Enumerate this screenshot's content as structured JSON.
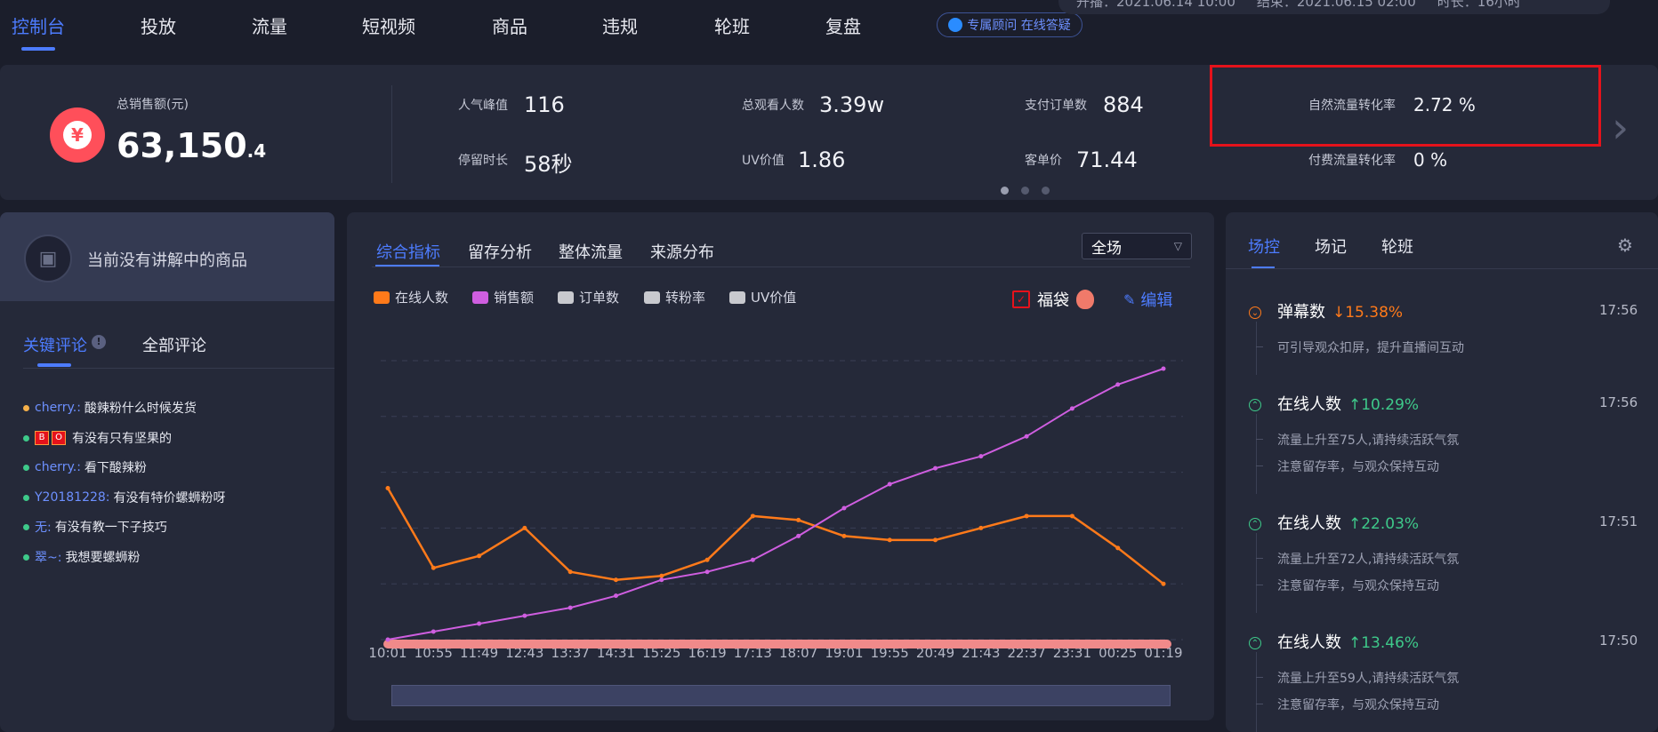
{
  "nav": {
    "items": [
      "控制台",
      "投放",
      "流量",
      "短视频",
      "商品",
      "违规",
      "轮班",
      "复盘"
    ],
    "advisor": "专属顾问 在线答疑",
    "live": {
      "start": "开播：2021.06.14 10:00",
      "end": "结束：2021.06.15 02:00",
      "duration": "时长：16小时"
    }
  },
  "stats": {
    "total_label": "总销售额(元)",
    "total_int": "63,150",
    "total_dec": ".4",
    "items": [
      {
        "label": "人气峰值",
        "value": "116"
      },
      {
        "label": "停留时长",
        "value": "58秒"
      },
      {
        "label": "总观看人数",
        "value": "3.39w"
      },
      {
        "label": "UV价值",
        "value": "1.86"
      },
      {
        "label": "支付订单数",
        "value": "884"
      },
      {
        "label": "客单价",
        "value": "71.44"
      },
      {
        "label": "自然流量转化率",
        "value": "2.72 %"
      },
      {
        "label": "付费流量转化率",
        "value": "0 %"
      }
    ]
  },
  "left": {
    "no_product": "当前没有讲解中的商品",
    "tabs": [
      "关键评论",
      "全部评论"
    ],
    "comments": [
      {
        "user": "cherry.:",
        "text": "酸辣粉什么时候发货",
        "dot": "#f5b04a"
      },
      {
        "user": "BO:",
        "text": "有没有只有坚果的",
        "dot": "#3ec98a"
      },
      {
        "user": "cherry.:",
        "text": "看下酸辣粉",
        "dot": "#3ec98a"
      },
      {
        "user": "Y20181228:",
        "text": "有没有特价螺蛳粉呀",
        "dot": "#3ec98a"
      },
      {
        "user": "无:",
        "text": "有没有教一下子技巧",
        "dot": "#3ec98a"
      },
      {
        "user": "翠~:",
        "text": "我想要螺蛳粉",
        "dot": "#3ec98a"
      }
    ]
  },
  "center": {
    "tabs": [
      "综合指标",
      "留存分析",
      "整体流量",
      "来源分布"
    ],
    "scope": "全场",
    "legend": [
      {
        "name": "在线人数",
        "color": "#ff7a1a"
      },
      {
        "name": "销售额",
        "color": "#cf5ee0"
      },
      {
        "name": "订单数",
        "color": "#c8c9ce"
      },
      {
        "name": "转粉率",
        "color": "#c8c9ce"
      },
      {
        "name": "UV价值",
        "color": "#c8c9ce"
      }
    ],
    "fudai": "福袋",
    "edit": "编辑"
  },
  "chart_data": {
    "type": "line",
    "x": [
      "10:01",
      "10:55",
      "11:49",
      "12:43",
      "13:37",
      "14:31",
      "15:25",
      "16:19",
      "17:13",
      "18:07",
      "19:01",
      "19:55",
      "20:49",
      "21:43",
      "22:37",
      "23:31",
      "00:25",
      "01:19"
    ],
    "series": [
      {
        "name": "在线人数",
        "color": "#ff7a1a",
        "values": [
          38,
          18,
          21,
          28,
          17,
          15,
          16,
          20,
          31,
          30,
          26,
          25,
          25,
          28,
          31,
          31,
          23,
          14
        ]
      },
      {
        "name": "销售额",
        "color": "#cf5ee0",
        "values": [
          0,
          2,
          4,
          6,
          8,
          11,
          15,
          17,
          20,
          26,
          33,
          39,
          43,
          46,
          51,
          58,
          64,
          68
        ]
      }
    ],
    "grid": true
  },
  "right": {
    "tabs": [
      "场控",
      "场记",
      "轮班"
    ],
    "events": [
      {
        "title": "弹幕数",
        "delta": "↓15.38%",
        "up": false,
        "time": "17:56",
        "notes": [
          "可引导观众扣屏，提升直播间互动"
        ]
      },
      {
        "title": "在线人数",
        "delta": "↑10.29%",
        "up": true,
        "time": "17:56",
        "notes": [
          "流量上升至75人,请持续活跃气氛",
          "注意留存率，与观众保持互动"
        ]
      },
      {
        "title": "在线人数",
        "delta": "↑22.03%",
        "up": true,
        "time": "17:51",
        "notes": [
          "流量上升至72人,请持续活跃气氛",
          "注意留存率，与观众保持互动"
        ]
      },
      {
        "title": "在线人数",
        "delta": "↑13.46%",
        "up": true,
        "time": "17:50",
        "notes": [
          "流量上升至59人,请持续活跃气氛",
          "注意留存率，与观众保持互动"
        ]
      }
    ]
  }
}
